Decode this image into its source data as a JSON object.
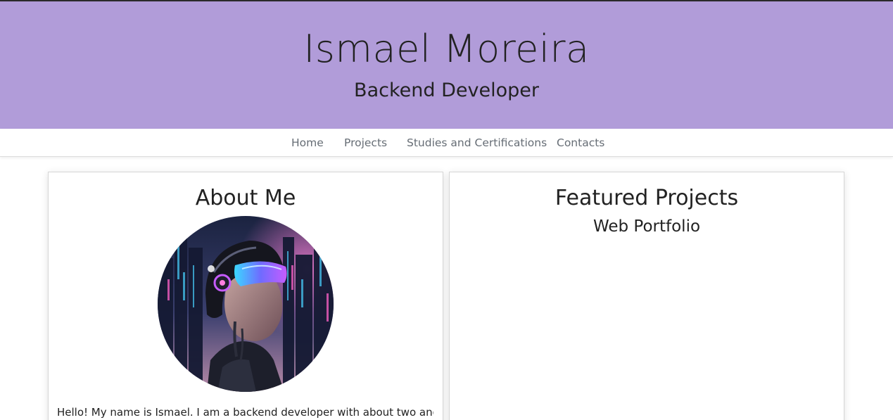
{
  "header": {
    "title": "Ismael Moreira",
    "subtitle": "Backend Developer",
    "background_color": "#b19cd9"
  },
  "nav": {
    "items": [
      {
        "label": "Home"
      },
      {
        "label": "Projects"
      },
      {
        "label": "Studies and Certifications"
      },
      {
        "label": "Contacts"
      }
    ]
  },
  "about": {
    "title": "About Me",
    "avatar_icon": "profile-avatar-cyberpunk-illustration",
    "bio": "Hello! My name is Ismael. I am a backend developer with about two and a"
  },
  "projects": {
    "title": "Featured Projects",
    "items": [
      {
        "name": "Web Portfolio"
      }
    ]
  }
}
